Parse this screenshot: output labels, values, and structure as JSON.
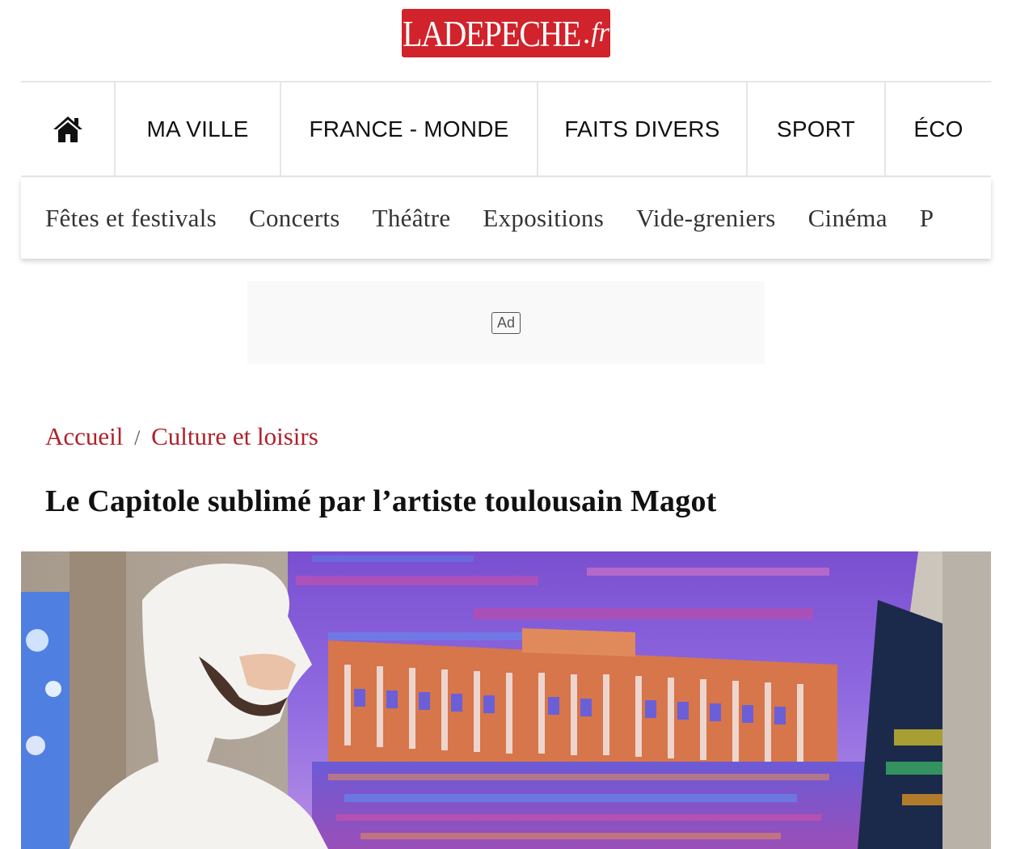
{
  "header": {
    "logo_brand": "LADEPECHE",
    "logo_dot": ".",
    "logo_tld": "fr"
  },
  "main_nav": {
    "home_icon": "home-icon",
    "items": [
      "MA VILLE",
      "FRANCE - MONDE",
      "FAITS DIVERS",
      "SPORT",
      "ÉCO"
    ]
  },
  "sub_nav": {
    "items": [
      "Fêtes et festivals",
      "Concerts",
      "Théâtre",
      "Expositions",
      "Vide-greniers",
      "Cinéma",
      "P"
    ]
  },
  "ad": {
    "label": "Ad"
  },
  "breadcrumb": {
    "home": "Accueil",
    "separator": "/",
    "section": "Culture et loisirs"
  },
  "article": {
    "title": "Le Capitole sublimé par l’artiste toulousain Magot"
  },
  "colors": {
    "brand_red": "#d0232b",
    "link_red": "#b0202a",
    "divider": "#e6e6e6"
  }
}
